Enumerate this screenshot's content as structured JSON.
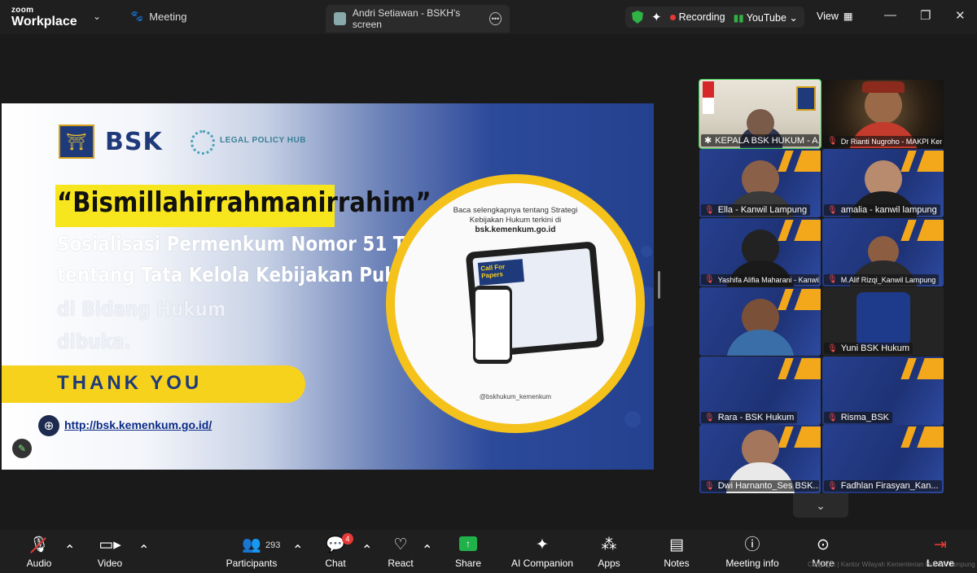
{
  "titlebar": {
    "logo_small": "zoom",
    "logo_big": "Workplace",
    "meeting_label": "Meeting",
    "screen_tab_label": "Andri Setiawan - BSKH's screen",
    "recording_label": "Recording",
    "youtube_label": "YouTube",
    "view_label": "View"
  },
  "shared_screen": {
    "brand": "BSK",
    "hub": "LEGAL POLICY HUB",
    "headline": "“Bismillahirrahmanirrahim”",
    "line1": "Sosialisasi Permenkum Nomor 51 Tahun 2025",
    "line2": "tentang Tata Kelola Kebijakan Publik",
    "line3": "di Bidang Hukum",
    "line4": "dibuka.",
    "thanks": "THANK YOU",
    "url": "http://bsk.kemenkum.go.id/",
    "circle_text_1": "Baca selengkapnya tentang Strategi",
    "circle_text_2": "Kebijakan Hukum terkini di",
    "circle_url": "bsk.kemenkum.go.id",
    "tablet_card": "Call For Papers",
    "socials": "@bskhukum_kemenkum"
  },
  "participants": [
    {
      "name": "KEPALA BSK HUKUM - A...",
      "muted": false
    },
    {
      "name": "Dr Rianti Nugroho - MAKPI Kemlum",
      "muted": true
    },
    {
      "name": "Ella - Kanwil Lampung",
      "muted": true
    },
    {
      "name": "amalia - kanwil lampung",
      "muted": true
    },
    {
      "name": "Yashifa Alifia Maharani - Kanwil La...",
      "muted": true
    },
    {
      "name": "M.Alif Rizqi_Kanwil Lampung",
      "muted": true
    },
    {
      "name": "",
      "muted": true
    },
    {
      "name": "Yuni BSK Hukum",
      "muted": true
    },
    {
      "name": "Rara - BSK Hukum",
      "muted": true
    },
    {
      "name": "Risma_BSK",
      "muted": true
    },
    {
      "name": "Dwi Harnanto_Ses BSK...",
      "muted": true
    },
    {
      "name": "Fadhlan Firasyan_Kan...",
      "muted": true
    }
  ],
  "toolbar": {
    "audio": "Audio",
    "video": "Video",
    "participants": "Participants",
    "participants_count": "293",
    "chat": "Chat",
    "chat_badge": "4",
    "react": "React",
    "share": "Share",
    "ai": "AI Companion",
    "apps": "Apps",
    "notes": "Notes",
    "info": "Meeting info",
    "more": "More",
    "leave": "Leave"
  },
  "watermark": "Copyright | Kantor Wilayah Kementerian Hukum Lampung",
  "colors": {
    "accent_green": "#21b14a",
    "record_red": "#e53935",
    "slide_yellow": "#f7d21d",
    "slide_blue": "#24418f"
  }
}
